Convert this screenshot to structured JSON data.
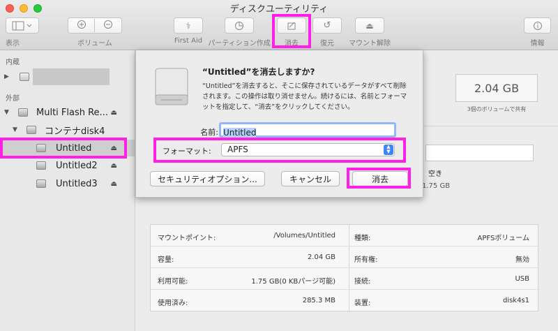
{
  "window": {
    "title": "ディスクユーティリティ"
  },
  "toolbar": {
    "view": "表示",
    "volume": "ボリューム",
    "first_aid": "First Aid",
    "partition": "パーティション作成",
    "erase": "消去",
    "restore": "復元",
    "unmount": "マウント解除",
    "info": "情報"
  },
  "sidebar": {
    "internal": "内蔵",
    "external": "外部",
    "items": [
      {
        "label": "Multi Flash Re..."
      },
      {
        "label": "コンテナdisk4"
      },
      {
        "label": "Untitled"
      },
      {
        "label": "Untitled2"
      },
      {
        "label": "Untitled3"
      }
    ]
  },
  "capacity": {
    "value": "2.04 GB",
    "shared": "3個のボリュームで共有"
  },
  "partial": {
    "free": "空き",
    "free_val": "1.75 GB"
  },
  "dialog": {
    "title": "“Untitled”を消去しますか?",
    "message": "“Untitled”を消去すると、そこに保存されているデータがすべて削除されます。この操作は取り消せません。続けるには、名前とフォーマットを指定して、“消去”をクリックしてください。",
    "name_label": "名前:",
    "name_value": "Untitled",
    "format_label": "フォーマット:",
    "format_value": "APFS",
    "security_button": "セキュリティオプション...",
    "cancel_button": "キャンセル",
    "erase_button": "消去"
  },
  "info": {
    "left": [
      {
        "k": "マウントポイント:",
        "v": "/Volumes/Untitled"
      },
      {
        "k": "容量:",
        "v": "2.04 GB"
      },
      {
        "k": "利用可能:",
        "v": "1.75 GB(0 KBパージ可能)"
      },
      {
        "k": "使用済み:",
        "v": "285.3 MB"
      }
    ],
    "right": [
      {
        "k": "種類:",
        "v": "APFSボリューム"
      },
      {
        "k": "所有権:",
        "v": "無効"
      },
      {
        "k": "接続:",
        "v": "USB"
      },
      {
        "k": "装置:",
        "v": "disk4s1"
      }
    ]
  },
  "colors": {
    "highlight": "#ff1fe5",
    "accent": "#3b86f7",
    "selection": "#cfcfcf"
  }
}
